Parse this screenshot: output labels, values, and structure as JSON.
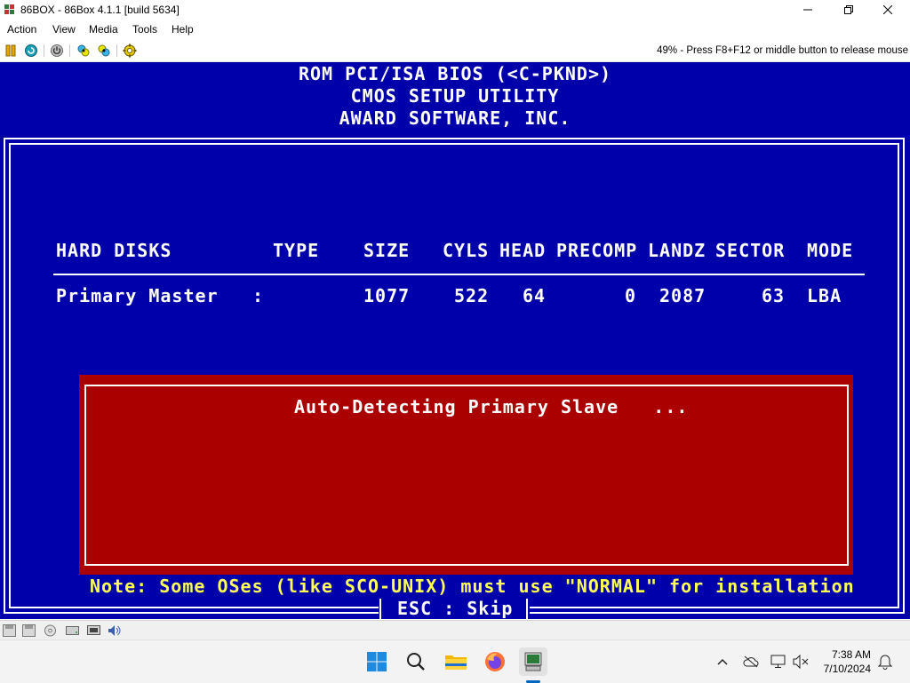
{
  "window": {
    "title": "86BOX - 86Box 4.1.1 [build 5634]",
    "menu": [
      "Action",
      "View",
      "Media",
      "Tools",
      "Help"
    ],
    "mouse_hint": "49% - Press F8+F12 or middle button to release mouse"
  },
  "bios": {
    "header": [
      "ROM PCI/ISA BIOS (<C-PKND>)",
      "CMOS SETUP UTILITY",
      "AWARD SOFTWARE, INC."
    ],
    "columns": {
      "hard_disks": "HARD DISKS",
      "type": "TYPE",
      "size": "SIZE",
      "cyls": "CYLS",
      "head": "HEAD",
      "precomp": "PRECOMP",
      "landz": "LANDZ",
      "sector": "SECTOR",
      "mode": "MODE"
    },
    "row": {
      "name": "Primary Master",
      "colon": ":",
      "size": "1077",
      "cyls": "522",
      "head": "64",
      "precomp": "0",
      "landz": "2087",
      "sector": "63",
      "mode": "LBA"
    },
    "dialog_text": "Auto-Detecting Primary Slave   ...",
    "note": "Note: Some OSes (like SCO-UNIX) must use \"NORMAL\" for installation",
    "esc": "ESC : Skip"
  },
  "taskbar": {
    "time": "7:38 AM",
    "date": "7/10/2024"
  },
  "colors": {
    "bios_blue": "#0000aa",
    "dialog_red": "#aa0000",
    "note_yellow": "#ffff55"
  }
}
